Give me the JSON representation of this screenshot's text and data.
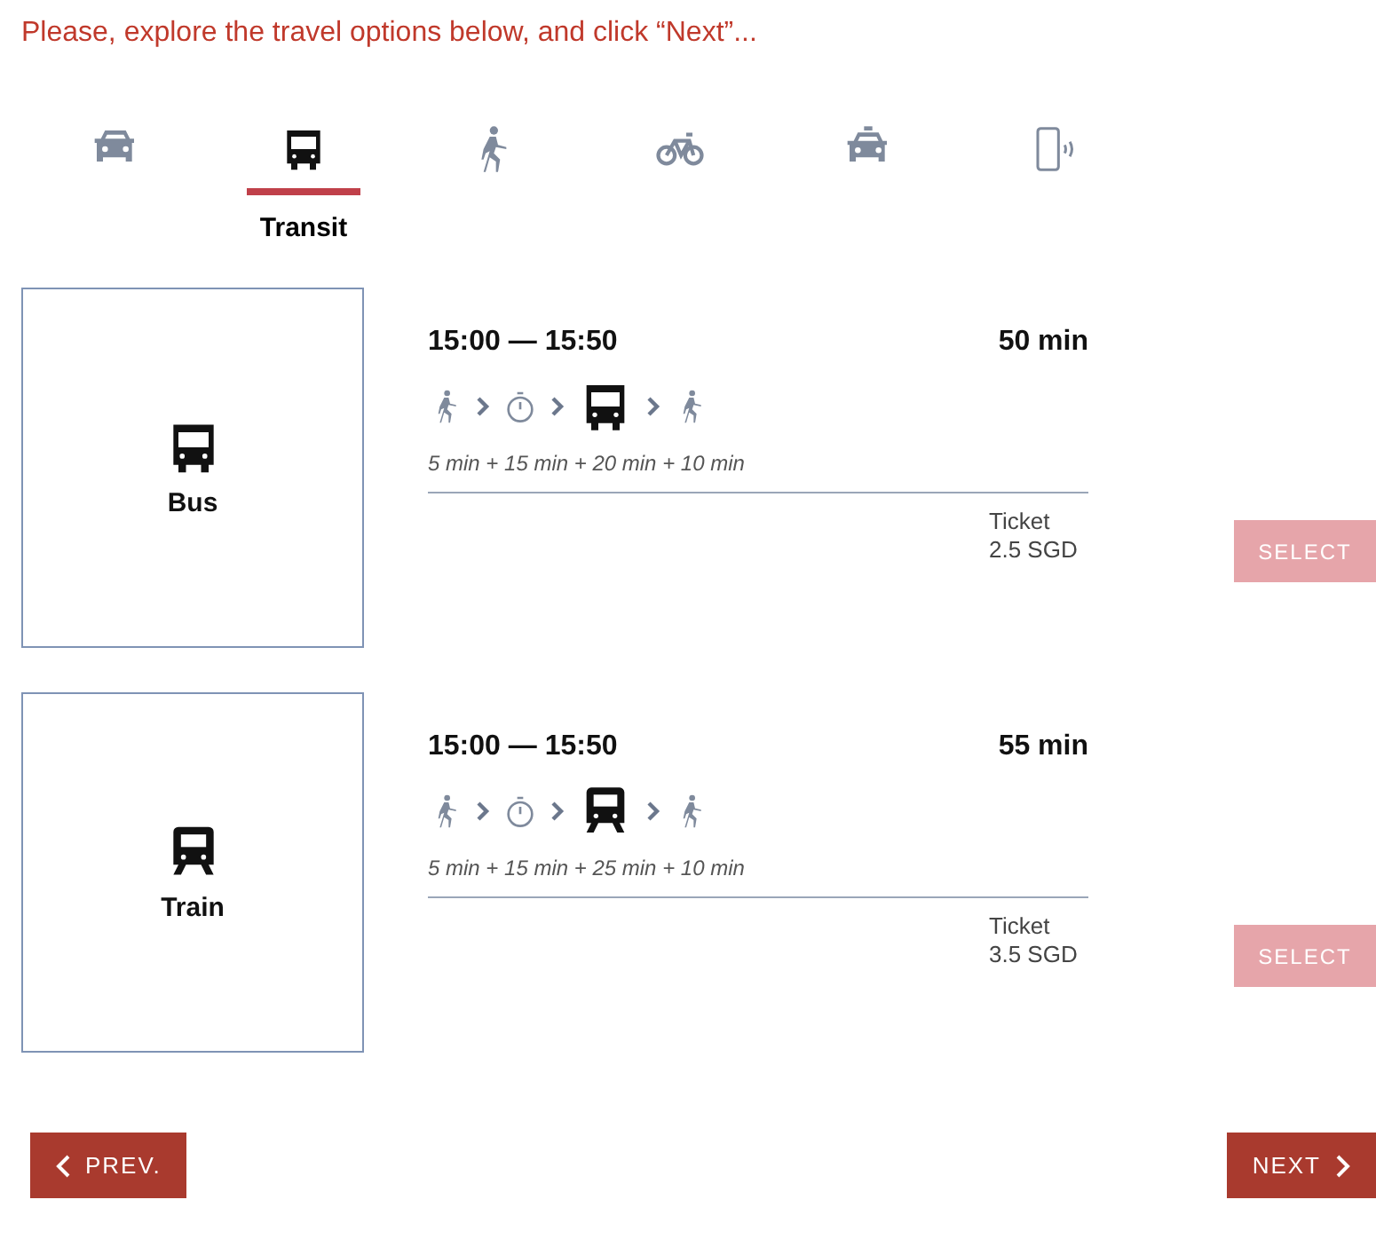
{
  "instruction": "Please, explore the travel options below, and click “Next”...",
  "modes": [
    {
      "kind": "car",
      "selected": false
    },
    {
      "kind": "bus",
      "selected": true,
      "label": "Transit"
    },
    {
      "kind": "walk",
      "selected": false
    },
    {
      "kind": "bike",
      "selected": false
    },
    {
      "kind": "taxi",
      "selected": false
    },
    {
      "kind": "phone",
      "selected": false
    }
  ],
  "options": [
    {
      "kind": "bus",
      "name": "Bus",
      "times": "15:00 — 15:50",
      "duration": "50 min",
      "legs": [
        {
          "kind": "walk"
        },
        {
          "kind": "wait"
        },
        {
          "kind": "bus"
        },
        {
          "kind": "walk"
        }
      ],
      "leg_times": "5 min + 15 min + 20 min + 10 min",
      "ticket_label": "Ticket",
      "price": "2.5 SGD",
      "button": {
        "label": "SELECT",
        "disabled": true
      }
    },
    {
      "kind": "train",
      "name": "Train",
      "times": "15:00 — 15:50",
      "duration": "55 min",
      "legs": [
        {
          "kind": "walk"
        },
        {
          "kind": "wait"
        },
        {
          "kind": "train"
        },
        {
          "kind": "walk"
        }
      ],
      "leg_times": "5 min + 15 min + 25 min + 10 min",
      "ticket_label": "Ticket",
      "price": "3.5 SGD",
      "button": {
        "label": "SELECT",
        "disabled": true
      }
    }
  ],
  "prev_button": "PREV.",
  "next_button": "NEXT"
}
